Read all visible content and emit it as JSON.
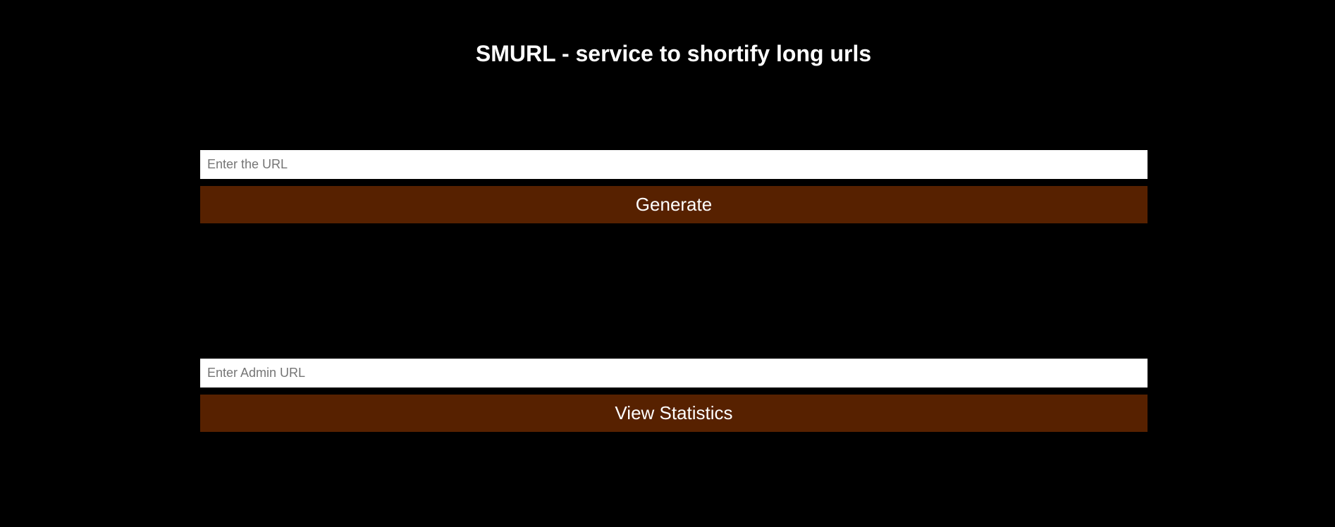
{
  "header": {
    "title": "SMURL - service to shortify long urls"
  },
  "generate_form": {
    "url_value": "",
    "url_placeholder": "Enter the URL",
    "button_label": "Generate"
  },
  "stats_form": {
    "admin_url_value": "",
    "admin_url_placeholder": "Enter Admin URL",
    "button_label": "View Statistics"
  },
  "colors": {
    "background": "#000000",
    "button": "#572100",
    "text": "#ffffff"
  }
}
